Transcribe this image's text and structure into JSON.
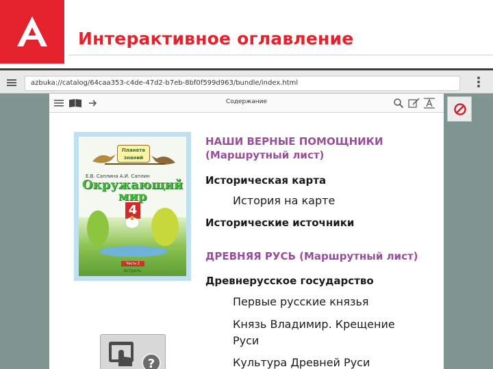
{
  "slide": {
    "title": "Интерактивное оглавление",
    "brand_color": "#e4222e"
  },
  "browser": {
    "url": "azbuka://catalog/64caa353-c4de-47d2-b7eb-8bf0f599d963/bundle/index.html"
  },
  "reader": {
    "toolbar_title": "Содержание",
    "cover": {
      "series": "Планета знаний",
      "authors": "Е.В. Саплина  А.И. Саплин",
      "title": "Окружающий мир",
      "grade": "4",
      "part": "Часть 2",
      "bottom": "Астрель"
    },
    "toc": [
      {
        "kind": "section",
        "text": "НАШИ ВЕРНЫЕ ПОМОЩНИКИ"
      },
      {
        "kind": "section",
        "text": "(Маршрутный лист)"
      },
      {
        "kind": "heading",
        "text": "Историческая карта"
      },
      {
        "kind": "link",
        "text": "История на карте"
      },
      {
        "kind": "heading",
        "text": "Исторические источники"
      },
      {
        "kind": "section",
        "text": "ДРЕВНЯЯ РУСЬ (Маршрутный лист)"
      },
      {
        "kind": "heading",
        "text": "Древнерусское государство"
      },
      {
        "kind": "link",
        "text": "Первые русские князья"
      },
      {
        "kind": "link",
        "text": "Князь Владимир. Крещение"
      },
      {
        "kind": "link",
        "text": "Руси"
      },
      {
        "kind": "link",
        "text": "Культура Древней Руси"
      }
    ]
  },
  "help": {
    "badge": "?"
  },
  "icons": [
    "logo-icon",
    "menu-icon",
    "more-icon",
    "list-icon",
    "book-icon",
    "arrow-right-icon",
    "search-icon",
    "edit-icon",
    "text-size-icon",
    "no-entry-icon",
    "touch-icon",
    "help-icon"
  ]
}
